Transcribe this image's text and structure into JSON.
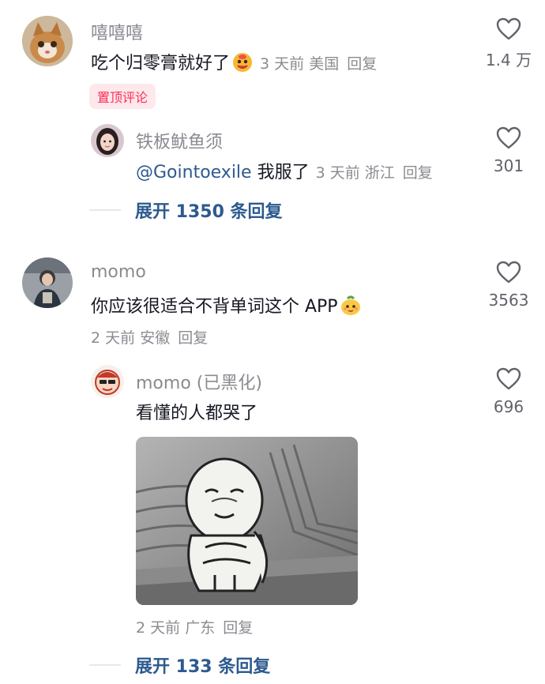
{
  "comments": [
    {
      "username": "嘻嘻嘻",
      "text": "吃个归零膏就好了",
      "time": "3 天前",
      "location": "美国",
      "reply_label": "回复",
      "likes": "1.4 万",
      "pin_label": "置顶评论",
      "reply": {
        "username": "铁板鱿鱼须",
        "mention": "@Gointoexile",
        "text": "我服了",
        "time": "3 天前",
        "location": "浙江",
        "reply_label": "回复",
        "likes": "301"
      },
      "expand_label": "展开 1350 条回复"
    },
    {
      "username": "momo",
      "text": "你应该很适合不背单词这个 APP",
      "time": "2 天前",
      "location": "安徽",
      "reply_label": "回复",
      "likes": "3563",
      "reply": {
        "username": "momo (已黑化)",
        "text": "看懂的人都哭了",
        "time": "2 天前",
        "location": "广东",
        "reply_label": "回复",
        "likes": "696"
      },
      "expand_label": "展开 133 条回复"
    }
  ],
  "icons": {
    "like": "heart-outline-icon",
    "emoji_face": "smiling-face-emoji",
    "emoji_pear": "cute-fruit-emoji",
    "sticker": "crying-meme-sticker"
  },
  "colors": {
    "text": "#161823",
    "secondary": "#8a8b91",
    "link": "#2c5a8e",
    "pin": "#fe2c55"
  }
}
